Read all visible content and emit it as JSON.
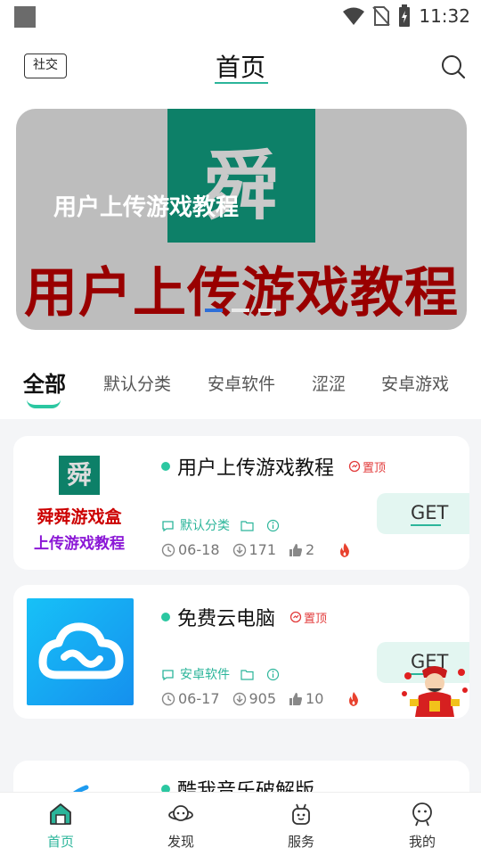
{
  "status_bar": {
    "time": "11:32"
  },
  "header": {
    "social_label": "社交",
    "title": "首页"
  },
  "banner": {
    "logo_char": "舜",
    "small_text": "用户上传游戏教程",
    "big_text": "用户上传游戏教程",
    "active_dot": 0,
    "dot_count": 3
  },
  "tabs": [
    {
      "label": "全部",
      "active": true
    },
    {
      "label": "默认分类"
    },
    {
      "label": "安卓软件"
    },
    {
      "label": "涩涩"
    },
    {
      "label": "安卓游戏"
    }
  ],
  "cards": [
    {
      "title": "用户上传游戏教程",
      "pin": "置顶",
      "category": "默认分类",
      "date": "06-18",
      "downloads": "171",
      "likes": "2",
      "get": "GET",
      "logo": {
        "char": "舜",
        "line1": "舜舜游戏盒",
        "line2": "上传游戏教程"
      }
    },
    {
      "title": "免费云电脑",
      "pin": "置顶",
      "category": "安卓软件",
      "date": "06-17",
      "downloads": "905",
      "likes": "10",
      "get": "GET"
    },
    {
      "title": "酷我音乐破解版"
    }
  ],
  "nav": [
    {
      "label": "首页",
      "icon": "home-icon",
      "active": true
    },
    {
      "label": "发现",
      "icon": "planet-icon"
    },
    {
      "label": "服务",
      "icon": "robot-icon"
    },
    {
      "label": "我的",
      "icon": "person-icon"
    }
  ],
  "colors": {
    "accent": "#2bb59a",
    "pin": "#e23b3b",
    "banner_text": "#990000"
  }
}
